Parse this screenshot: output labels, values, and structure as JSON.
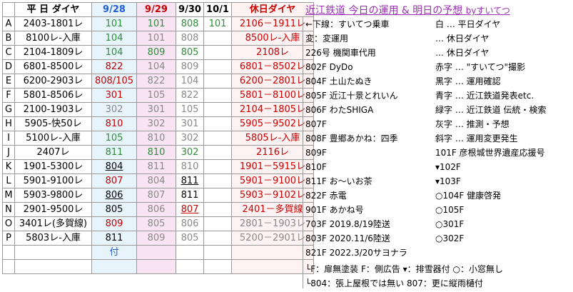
{
  "header": {
    "weekday_label": "平 日 ダイヤ",
    "date1": "9/28",
    "date2": "9/29",
    "date3": "9/30",
    "date4": "10/1",
    "holiday_label": "休日ダイヤ"
  },
  "title": {
    "main": "近江鉄道 今日の運用 & 明日の予想",
    "by": "byすいてつ"
  },
  "rows": [
    {
      "key": "A",
      "train": "2403-1801レ",
      "d1": "101",
      "d2": "101",
      "d3": "808",
      "d4": "101",
      "hol": "2106－1911レ"
    },
    {
      "key": "B",
      "train": "8100レ-入庫",
      "d1": "104",
      "d2": "101",
      "d3": "808",
      "d4": "",
      "hol": "8500レ-入庫"
    },
    {
      "key": "C",
      "train": "2104-1809レ",
      "d1": "104",
      "d2": "809",
      "d3": "805",
      "d4": "",
      "hol": "2108レ"
    },
    {
      "key": "D",
      "train": "6801-8500レ",
      "d1": "822",
      "d2": "104",
      "d3": "809",
      "d4": "",
      "hol": "6801－8502レ"
    },
    {
      "key": "E",
      "train": "6200-2903レ",
      "d1": "808/105",
      "d2": "822",
      "d3": "104",
      "d4": "",
      "hol": "6200－2801レ"
    },
    {
      "key": "F",
      "train": "5801-8506レ",
      "d1": "301",
      "d2": "105",
      "d3": "822",
      "d4": "",
      "hol": "5801－8100レ"
    },
    {
      "key": "G",
      "train": "2100-1903レ",
      "d1": "302",
      "d2": "301",
      "d3": "105",
      "d4": "",
      "hol": "2104－1805レ"
    },
    {
      "key": "H",
      "train": "5905-快50レ",
      "d1": "810",
      "d2": "302",
      "d3": "301",
      "d4": "",
      "hol": "5905－9502レ"
    },
    {
      "key": "I",
      "train": "5100レ-入庫",
      "d1": "105",
      "d2": "810",
      "d3": "302",
      "d4": "",
      "hol": "5805レ-入庫"
    },
    {
      "key": "J",
      "train": "2407レ",
      "d1": "811",
      "d2": "810",
      "d3": "302",
      "d4": "",
      "hol": "2116レ"
    },
    {
      "key": "K",
      "train": "1901-5300レ",
      "d1": "804",
      "d2": "811",
      "d3": "810",
      "d4": "",
      "hol": "1901－5915レ"
    },
    {
      "key": "L",
      "train": "5901-9100レ",
      "d1": "807",
      "d2": "804",
      "d3": "811",
      "d4": "",
      "hol": "5901－9100レ"
    },
    {
      "key": "M",
      "train": "5903-9800レ",
      "d1": "806",
      "d2": "807",
      "d3": "811",
      "d4": "",
      "hol": "5903－9102レ"
    },
    {
      "key": "N",
      "train": "2901-9500レ",
      "d1": "805",
      "d2": "806",
      "d3": "807",
      "d4": "",
      "hol": "2401－多賀線"
    },
    {
      "key": "O",
      "train": "3401レ(多賀線)",
      "d1": "809",
      "d2": "805",
      "d3": "806",
      "d4": "",
      "hol": "2801－1903レ"
    },
    {
      "key": "P",
      "train": "5803レ-入庫",
      "d1": "811",
      "d2": "809",
      "d3": "805",
      "d4": "",
      "hol": "5200－2901レ"
    }
  ],
  "footer": {
    "note": "付"
  },
  "legend": [
    {
      "t": "←下線：すいてつ乗車"
    },
    {
      "t": "変：変運用"
    },
    {
      "t": "226号 機関車代用"
    },
    {
      "t": "802F  DyDo"
    },
    {
      "t": "804F  土山たぬき"
    },
    {
      "t": "805F  近江十景とれいん"
    },
    {
      "t": "806F  わたSHIGA"
    },
    {
      "t": "807F"
    },
    {
      "t": "808F  豊郷あかね：四季"
    },
    {
      "t": "809F"
    },
    {
      "t": "810F"
    },
    {
      "t": "811F  お～いお茶"
    },
    {
      "t": "822F  赤電"
    },
    {
      "t": "901F  あかね号"
    },
    {
      "t": "703F  2019.8/19陸送"
    },
    {
      "t": "803F  2020.11/6陸送"
    },
    {
      "t": "821F  2022.3/20サヨナラ"
    }
  ],
  "legend2": [
    {
      "t": "白 … 平日ダイヤ"
    },
    {
      "t": "… 休日ダイヤ"
    },
    {
      "t": "… 休日ダイヤ"
    },
    {
      "t": "赤字 … \"すいてつ\"撮影"
    },
    {
      "t": "黒字 … 運用確認"
    },
    {
      "t": "青字 … 近江鉄道発表etc."
    },
    {
      "t": "緑字 … 近江鉄道 伝統・検索"
    },
    {
      "t": "灰字 … 推測・予想"
    },
    {
      "t": "斜字 … 運用変更発生"
    },
    {
      "t": "101F  彦根城世界遺産応援号"
    },
    {
      "t": "▾102F"
    },
    {
      "t": "▾103F"
    },
    {
      "t": "○104F  健康啓発"
    },
    {
      "t": "○105F"
    },
    {
      "t": "○301F"
    },
    {
      "t": "○302F"
    }
  ],
  "bottom": {
    "line1": "└F：扉無塗装  F：側広告  ▾：排雪器付  ○：小窓無し",
    "line2": "└804：張上屋根では無い  807：更に縦雨樋付"
  }
}
